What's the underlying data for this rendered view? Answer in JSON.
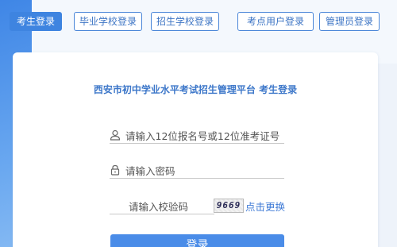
{
  "tabs": [
    {
      "label": "考生登录",
      "active": true
    },
    {
      "label": "毕业学校登录",
      "active": false
    },
    {
      "label": "招生学校登录",
      "active": false
    },
    {
      "label": "考点用户登录",
      "active": false
    },
    {
      "label": "管理员登录",
      "active": false
    }
  ],
  "form": {
    "title": "西安市初中学业水平考试招生管理平台 考生登录",
    "id_placeholder": "请输入12位报名号或12位准考证号",
    "password_placeholder": "请输入密码",
    "captcha_placeholder": "请输入校验码",
    "captcha_value": "9669",
    "refresh_label": "点击更换",
    "login_label": "登录"
  },
  "colors": {
    "accent": "#3e84e0",
    "title": "#3d77c9",
    "link": "#3e7ad6",
    "button": "#4a8ce8"
  },
  "icons": {
    "id_field": "user-icon",
    "password_field": "lock-icon"
  }
}
